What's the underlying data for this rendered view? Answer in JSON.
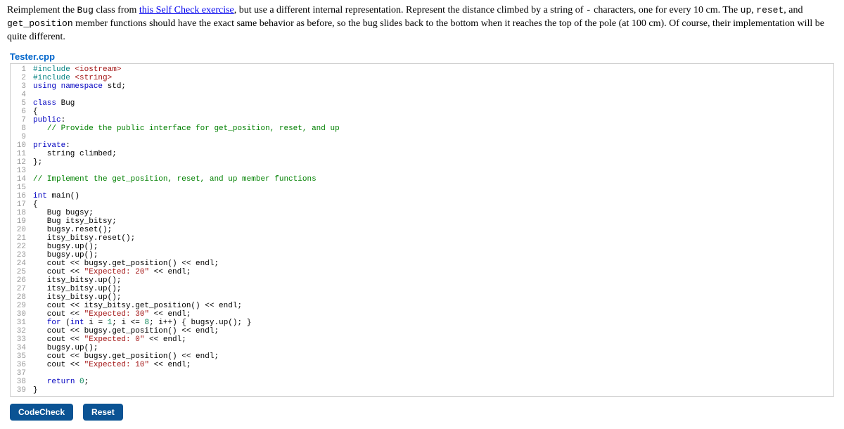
{
  "instructions": {
    "pre1": "Reimplement the ",
    "cls": "Bug",
    "pre2": " class from ",
    "link_text": "this Self Check exercise",
    "post_link": ", but use a different internal representation. Represent the distance climbed by a string of ",
    "dash": "-",
    "post_dash": " characters, one for every 10 cm. The ",
    "fn_up": "up",
    "sep1": ", ",
    "fn_reset": "reset",
    "sep2": ", and ",
    "fn_getpos": "get_position",
    "post_fns": " member functions should have the exact same behavior as before, so the bug slides back to the bottom when it reaches the top of the pole (at 100 cm). Of course, their implementation will be quite different."
  },
  "filename": "Tester.cpp",
  "buttons": {
    "codecheck": "CodeCheck",
    "reset": "Reset"
  },
  "code": [
    {
      "n": 1,
      "tokens": [
        [
          "preproc",
          "#include "
        ],
        [
          "string",
          "<iostream>"
        ]
      ]
    },
    {
      "n": 2,
      "tokens": [
        [
          "preproc",
          "#include "
        ],
        [
          "string",
          "<string>"
        ]
      ]
    },
    {
      "n": 3,
      "tokens": [
        [
          "keyword",
          "using "
        ],
        [
          "keyword",
          "namespace "
        ],
        [
          "",
          "std;"
        ]
      ]
    },
    {
      "n": 4,
      "tokens": [
        [
          "",
          ""
        ]
      ]
    },
    {
      "n": 5,
      "tokens": [
        [
          "keyword",
          "class "
        ],
        [
          "",
          "Bug"
        ]
      ]
    },
    {
      "n": 6,
      "tokens": [
        [
          "",
          "{"
        ]
      ]
    },
    {
      "n": 7,
      "tokens": [
        [
          "keyword",
          "public"
        ],
        [
          "",
          ":"
        ]
      ]
    },
    {
      "n": 8,
      "tokens": [
        [
          "",
          "   "
        ],
        [
          "comment",
          "// Provide the public interface for get_position, reset, and up"
        ]
      ]
    },
    {
      "n": 9,
      "tokens": [
        [
          "",
          ""
        ]
      ]
    },
    {
      "n": 10,
      "tokens": [
        [
          "keyword",
          "private"
        ],
        [
          "",
          ":"
        ]
      ]
    },
    {
      "n": 11,
      "tokens": [
        [
          "",
          "   string climbed;"
        ]
      ]
    },
    {
      "n": 12,
      "tokens": [
        [
          "",
          "};"
        ]
      ]
    },
    {
      "n": 13,
      "tokens": [
        [
          "",
          ""
        ]
      ]
    },
    {
      "n": 14,
      "tokens": [
        [
          "comment",
          "// Implement the get_position, reset, and up member functions"
        ]
      ]
    },
    {
      "n": 15,
      "tokens": [
        [
          "",
          ""
        ]
      ]
    },
    {
      "n": 16,
      "tokens": [
        [
          "type",
          "int "
        ],
        [
          "",
          "main()"
        ]
      ]
    },
    {
      "n": 17,
      "tokens": [
        [
          "",
          "{"
        ]
      ]
    },
    {
      "n": 18,
      "tokens": [
        [
          "",
          "   Bug bugsy;"
        ]
      ]
    },
    {
      "n": 19,
      "tokens": [
        [
          "",
          "   Bug itsy_bitsy;"
        ]
      ]
    },
    {
      "n": 20,
      "tokens": [
        [
          "",
          "   bugsy.reset();"
        ]
      ]
    },
    {
      "n": 21,
      "tokens": [
        [
          "",
          "   itsy_bitsy.reset();"
        ]
      ]
    },
    {
      "n": 22,
      "tokens": [
        [
          "",
          "   bugsy.up();"
        ]
      ]
    },
    {
      "n": 23,
      "tokens": [
        [
          "",
          "   bugsy.up();"
        ]
      ]
    },
    {
      "n": 24,
      "tokens": [
        [
          "",
          "   cout << bugsy.get_position() << endl;"
        ]
      ]
    },
    {
      "n": 25,
      "tokens": [
        [
          "",
          "   cout << "
        ],
        [
          "string",
          "\"Expected: 20\""
        ],
        [
          "",
          " << endl;"
        ]
      ]
    },
    {
      "n": 26,
      "tokens": [
        [
          "",
          "   itsy_bitsy.up();"
        ]
      ]
    },
    {
      "n": 27,
      "tokens": [
        [
          "",
          "   itsy_bitsy.up();"
        ]
      ]
    },
    {
      "n": 28,
      "tokens": [
        [
          "",
          "   itsy_bitsy.up();"
        ]
      ]
    },
    {
      "n": 29,
      "tokens": [
        [
          "",
          "   cout << itsy_bitsy.get_position() << endl;"
        ]
      ]
    },
    {
      "n": 30,
      "tokens": [
        [
          "",
          "   cout << "
        ],
        [
          "string",
          "\"Expected: 30\""
        ],
        [
          "",
          " << endl;"
        ]
      ]
    },
    {
      "n": 31,
      "tokens": [
        [
          "",
          "   "
        ],
        [
          "keyword",
          "for"
        ],
        [
          "",
          " ("
        ],
        [
          "type",
          "int"
        ],
        [
          "",
          " i = "
        ],
        [
          "number",
          "1"
        ],
        [
          "",
          "; i <= "
        ],
        [
          "number",
          "8"
        ],
        [
          "",
          "; i++) { bugsy.up(); }"
        ]
      ]
    },
    {
      "n": 32,
      "tokens": [
        [
          "",
          "   cout << bugsy.get_position() << endl;"
        ]
      ]
    },
    {
      "n": 33,
      "tokens": [
        [
          "",
          "   cout << "
        ],
        [
          "string",
          "\"Expected: 0\""
        ],
        [
          "",
          " << endl;"
        ]
      ]
    },
    {
      "n": 34,
      "tokens": [
        [
          "",
          "   bugsy.up();"
        ]
      ]
    },
    {
      "n": 35,
      "tokens": [
        [
          "",
          "   cout << bugsy.get_position() << endl;"
        ]
      ]
    },
    {
      "n": 36,
      "tokens": [
        [
          "",
          "   cout << "
        ],
        [
          "string",
          "\"Expected: 10\""
        ],
        [
          "",
          " << endl;"
        ]
      ]
    },
    {
      "n": 37,
      "tokens": [
        [
          "",
          ""
        ]
      ]
    },
    {
      "n": 38,
      "tokens": [
        [
          "",
          "   "
        ],
        [
          "keyword",
          "return"
        ],
        [
          "",
          " "
        ],
        [
          "number",
          "0"
        ],
        [
          "",
          ";"
        ]
      ]
    },
    {
      "n": 39,
      "tokens": [
        [
          "",
          "}"
        ]
      ]
    }
  ]
}
